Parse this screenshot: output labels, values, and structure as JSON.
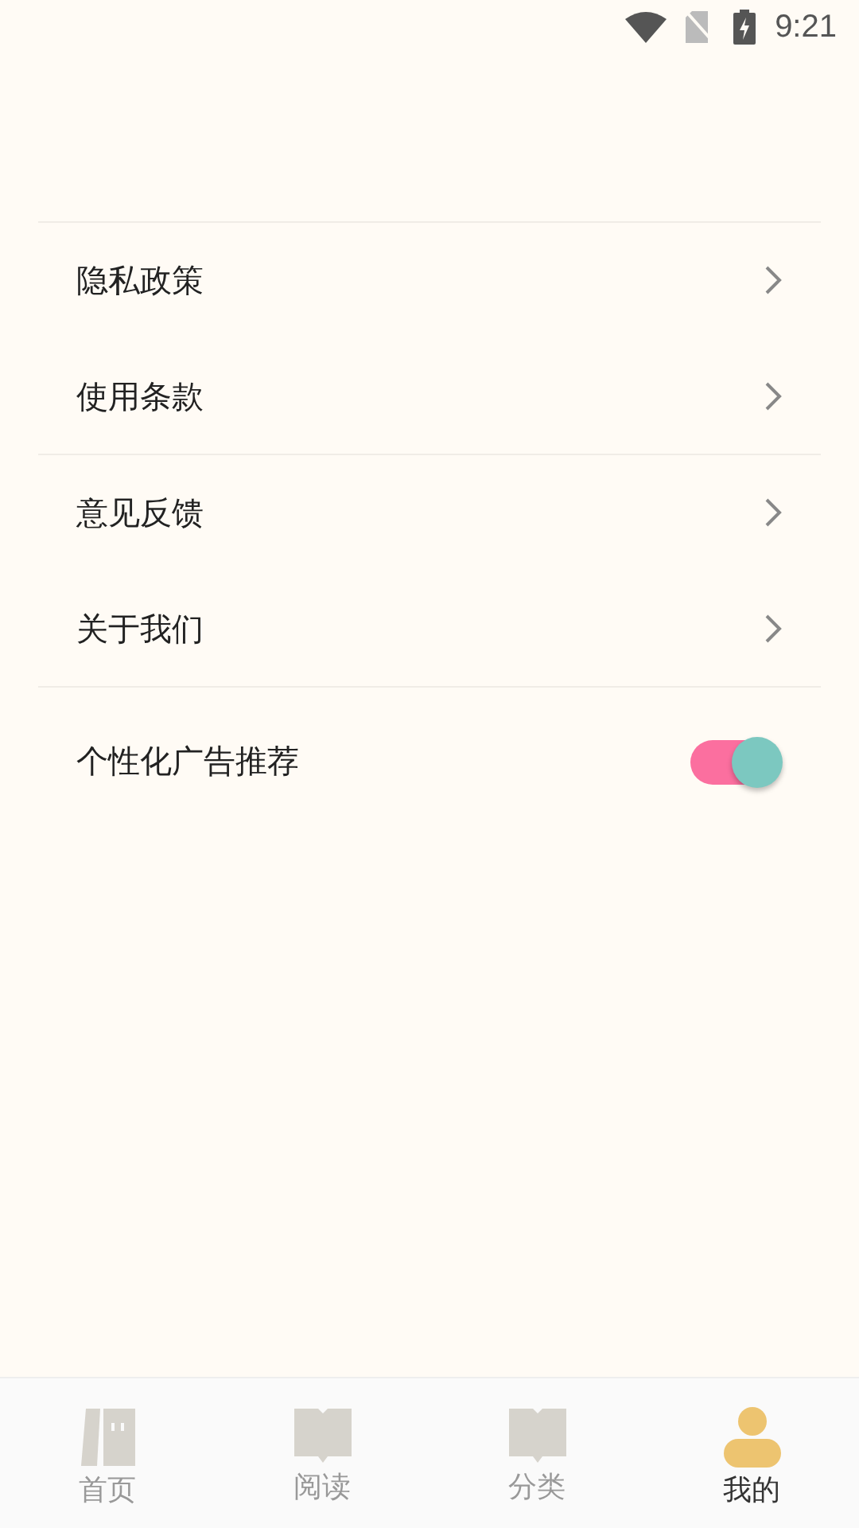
{
  "status_bar": {
    "time": "9:21"
  },
  "settings": [
    {
      "kind": "link",
      "label": "隐私政策",
      "divider": false
    },
    {
      "kind": "link",
      "label": "使用条款",
      "divider": true
    },
    {
      "kind": "link",
      "label": "意见反馈",
      "divider": false
    },
    {
      "kind": "link",
      "label": "关于我们",
      "divider": true
    },
    {
      "kind": "toggle",
      "label": "个性化广告推荐",
      "on": true,
      "divider": false
    }
  ],
  "bottom_nav": [
    {
      "kind": "shelf",
      "label": "首页",
      "selected": false
    },
    {
      "kind": "book",
      "label": "阅读",
      "selected": false
    },
    {
      "kind": "book",
      "label": "分类",
      "selected": false
    },
    {
      "kind": "person",
      "label": "我的",
      "selected": true
    }
  ]
}
